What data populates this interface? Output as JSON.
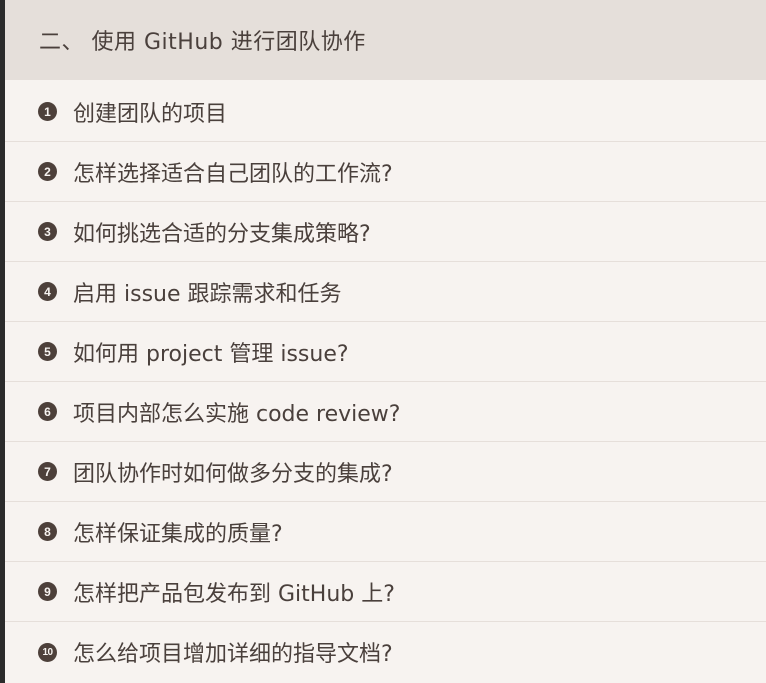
{
  "header": {
    "title": "二、 使用 GitHub 进行团队协作"
  },
  "items": [
    {
      "num": "1",
      "label": "创建团队的项目"
    },
    {
      "num": "2",
      "label": "怎样选择适合自己团队的工作流?"
    },
    {
      "num": "3",
      "label": "如何挑选合适的分支集成策略?"
    },
    {
      "num": "4",
      "label": "启用 issue 跟踪需求和任务"
    },
    {
      "num": "5",
      "label": "如何用 project 管理 issue?"
    },
    {
      "num": "6",
      "label": "项目内部怎么实施 code review?"
    },
    {
      "num": "7",
      "label": "团队协作时如何做多分支的集成?"
    },
    {
      "num": "8",
      "label": "怎样保证集成的质量?"
    },
    {
      "num": "9",
      "label": "怎样把产品包发布到 GitHub 上?"
    },
    {
      "num": "10",
      "label": "怎么给项目增加详细的指导文档?"
    }
  ]
}
